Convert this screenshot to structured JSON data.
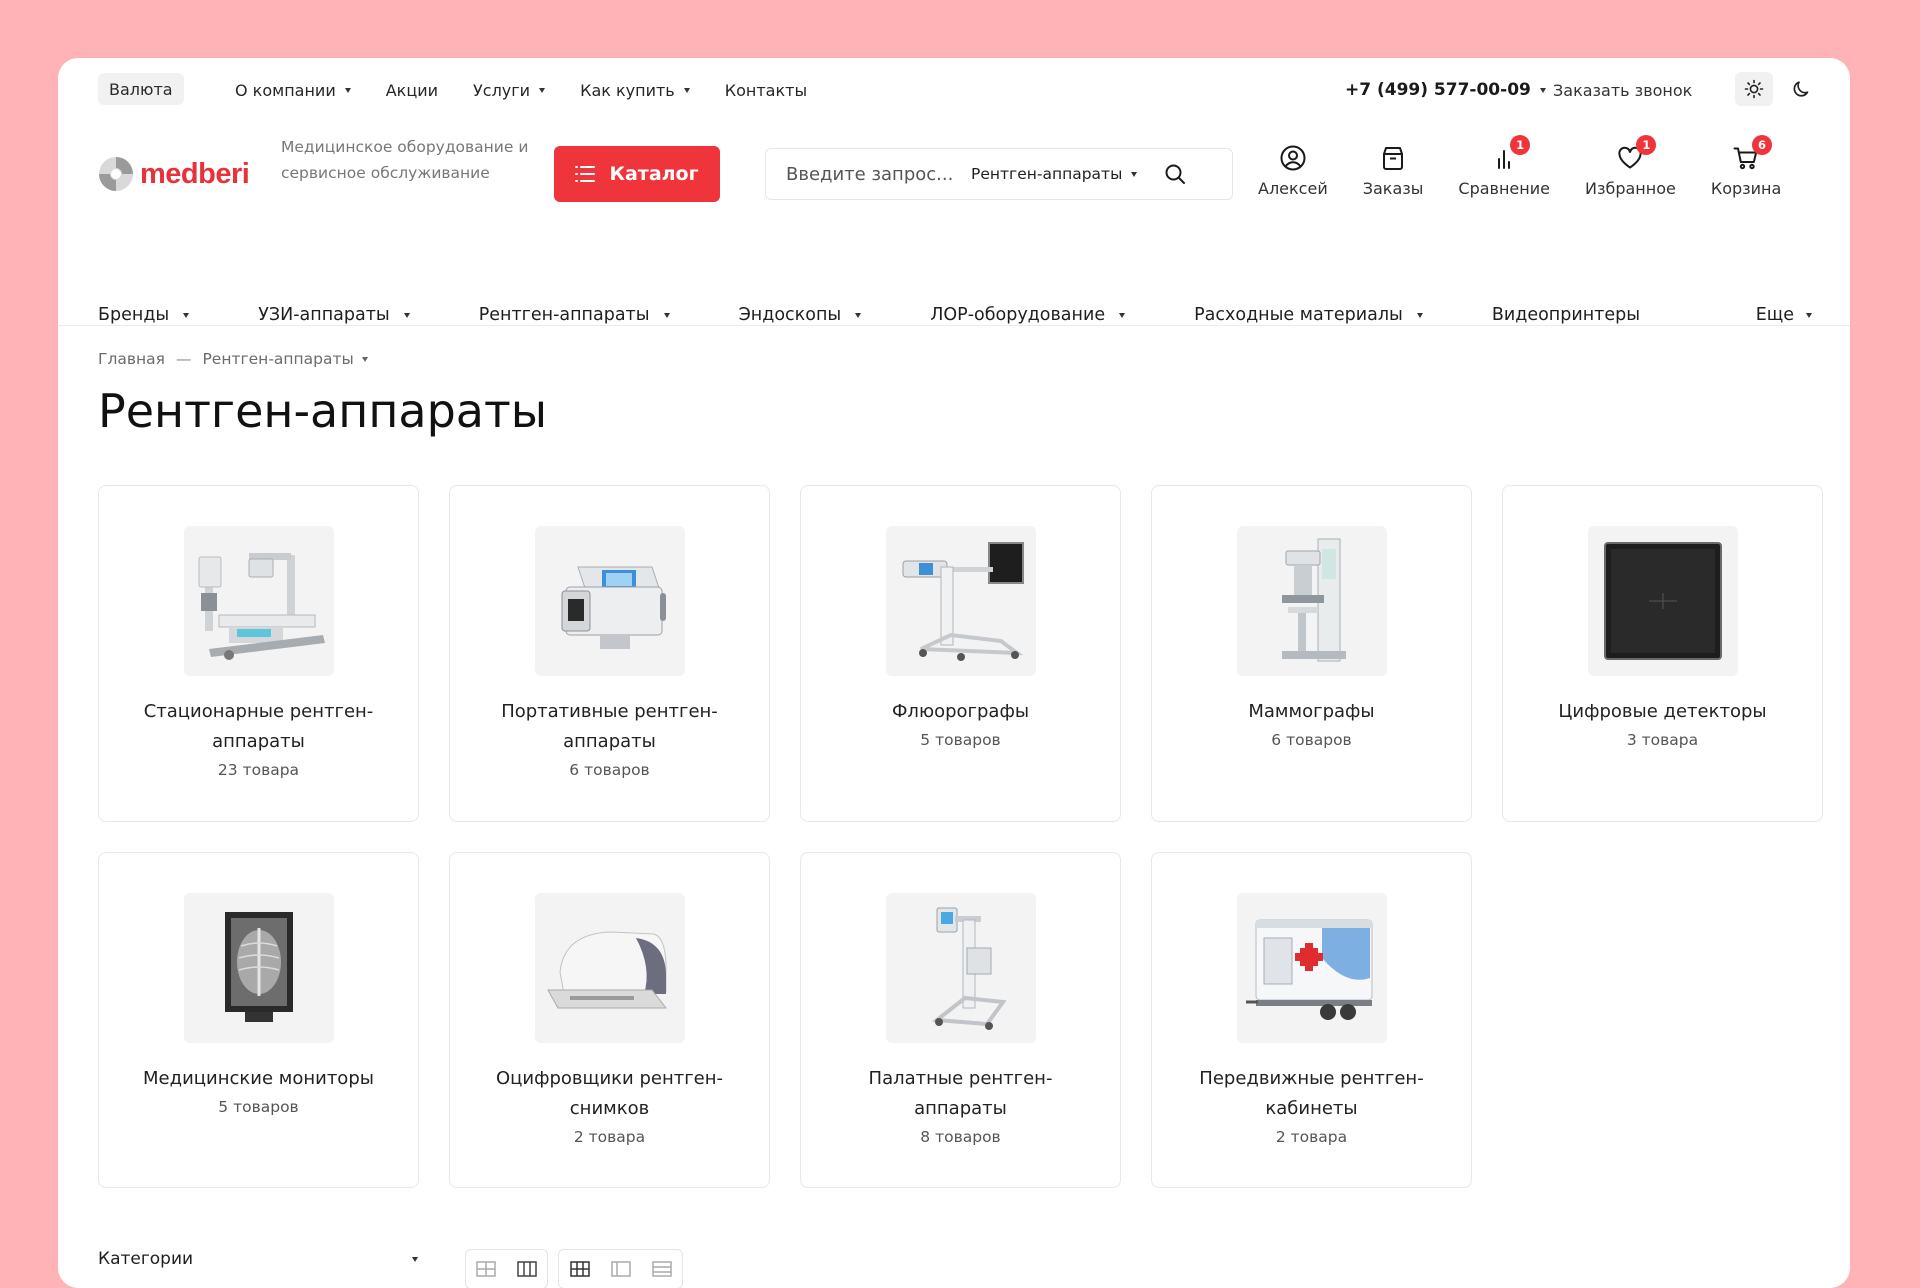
{
  "topbar": {
    "currency_label": "Валюта",
    "nav": [
      {
        "label": "О компании",
        "has_dropdown": true
      },
      {
        "label": "Акции",
        "has_dropdown": false
      },
      {
        "label": "Услуги",
        "has_dropdown": true
      },
      {
        "label": "Как купить",
        "has_dropdown": true
      },
      {
        "label": "Контакты",
        "has_dropdown": false
      }
    ],
    "phone": "+7 (499) 577-00-09",
    "callback_label": "Заказать звонок",
    "theme_icons": [
      "sun-icon",
      "moon-icon"
    ]
  },
  "header": {
    "logo_text": "medberi",
    "tagline": "Медицинское оборудование и сервисное обслуживание",
    "catalog_label": "Каталог",
    "search": {
      "placeholder": "Введите запрос...",
      "scope": "Рентген-аппараты"
    },
    "icons": [
      {
        "name": "user-icon",
        "label": "Алексей",
        "badge": ""
      },
      {
        "name": "orders-icon",
        "label": "Заказы",
        "badge": ""
      },
      {
        "name": "compare-icon",
        "label": "Сравнение",
        "badge": "1"
      },
      {
        "name": "heart-icon",
        "label": "Избранное",
        "badge": "1"
      },
      {
        "name": "cart-icon",
        "label": "Корзина",
        "badge": "6"
      }
    ]
  },
  "main_menu": {
    "items": [
      {
        "label": "Бренды",
        "has_dropdown": true
      },
      {
        "label": "УЗИ-аппараты",
        "has_dropdown": true
      },
      {
        "label": "Рентген-аппараты",
        "has_dropdown": true
      },
      {
        "label": "Эндоскопы",
        "has_dropdown": true
      },
      {
        "label": "ЛОР-оборудование",
        "has_dropdown": true
      },
      {
        "label": "Расходные материалы",
        "has_dropdown": true
      },
      {
        "label": "Видеопринтеры",
        "has_dropdown": false
      }
    ],
    "more_label": "Еще"
  },
  "breadcrumb": {
    "home": "Главная",
    "separator": "—",
    "current": "Рентген-аппараты"
  },
  "page_title": "Рентген-аппараты",
  "categories": [
    {
      "title": "Стационарные рентген-аппараты",
      "count": "23 товара",
      "icon": "stationary-xray"
    },
    {
      "title": "Портативные рентген-аппараты",
      "count": "6 товаров",
      "icon": "portable-xray"
    },
    {
      "title": "Флюорографы",
      "count": "5 товаров",
      "icon": "fluorograph"
    },
    {
      "title": "Маммографы",
      "count": "6 товаров",
      "icon": "mammograph"
    },
    {
      "title": "Цифровые детекторы",
      "count": "3 товара",
      "icon": "digital-detector"
    },
    {
      "title": "Медицинские мониторы",
      "count": "5 товаров",
      "icon": "medical-monitor"
    },
    {
      "title": "Оцифровщики рентген-снимков",
      "count": "2 товара",
      "icon": "xray-digitizer"
    },
    {
      "title": "Палатные рентген-аппараты",
      "count": "8 товаров",
      "icon": "ward-xray"
    },
    {
      "title": "Передвижные рентген-кабинеты",
      "count": "2 товара",
      "icon": "mobile-xray-cabinet"
    }
  ],
  "sort_bar": {
    "categories_label": "Категории"
  },
  "colors": {
    "accent": "#f0343c",
    "background": "#ffb3b6"
  }
}
